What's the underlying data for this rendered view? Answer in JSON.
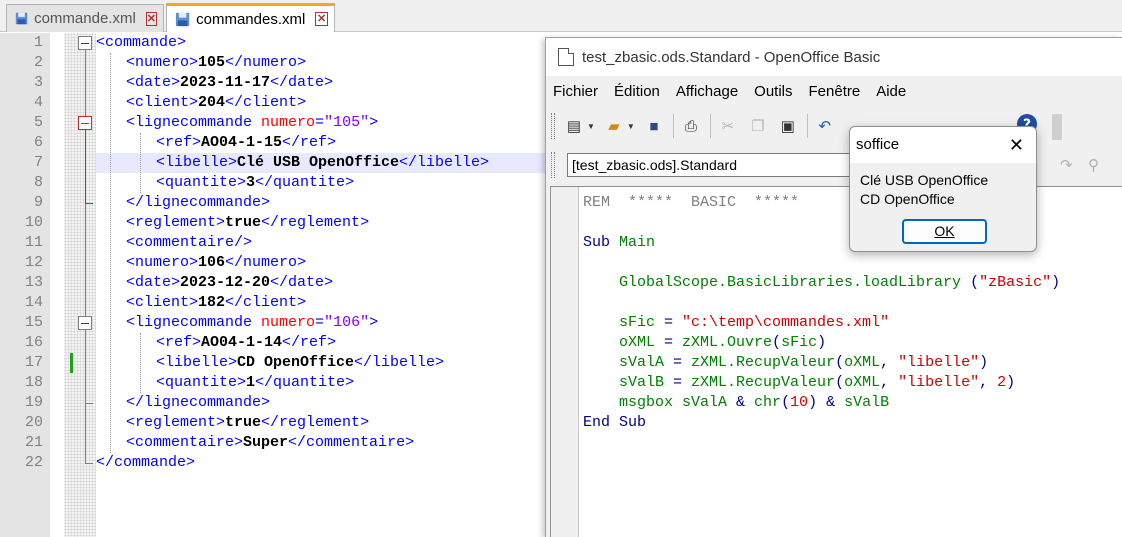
{
  "notepad": {
    "tabs": [
      {
        "label": "commande.xml"
      },
      {
        "label": "commandes.xml"
      }
    ]
  },
  "editor": {
    "lines": [
      {
        "n": "1",
        "seg": [
          [
            "t",
            "<commande>"
          ]
        ]
      },
      {
        "n": "2",
        "seg": [
          [
            "t",
            "<numero>"
          ],
          [
            "c",
            "105"
          ],
          [
            "t",
            "</numero>"
          ]
        ]
      },
      {
        "n": "3",
        "seg": [
          [
            "t",
            "<date>"
          ],
          [
            "c",
            "2023-11-17"
          ],
          [
            "t",
            "</date>"
          ]
        ]
      },
      {
        "n": "4",
        "seg": [
          [
            "t",
            "<client>"
          ],
          [
            "c",
            "204"
          ],
          [
            "t",
            "</client>"
          ]
        ]
      },
      {
        "n": "5",
        "seg": [
          [
            "t",
            "<lignecommande "
          ],
          [
            "a",
            "numero"
          ],
          [
            "t",
            "="
          ],
          [
            "v",
            "\"105\""
          ],
          [
            "t",
            ">"
          ]
        ]
      },
      {
        "n": "6",
        "seg": [
          [
            "t",
            "<ref>"
          ],
          [
            "c",
            "AO04-1-15"
          ],
          [
            "t",
            "</ref>"
          ]
        ]
      },
      {
        "n": "7",
        "seg": [
          [
            "t",
            "<libelle>"
          ],
          [
            "c",
            "Clé USB OpenOffice"
          ],
          [
            "t",
            "</libelle>"
          ]
        ]
      },
      {
        "n": "8",
        "seg": [
          [
            "t",
            "<quantite>"
          ],
          [
            "c",
            "3"
          ],
          [
            "t",
            "</quantite>"
          ]
        ]
      },
      {
        "n": "9",
        "seg": [
          [
            "t",
            "</lignecommande>"
          ]
        ]
      },
      {
        "n": "10",
        "seg": [
          [
            "t",
            "<reglement>"
          ],
          [
            "c",
            "true"
          ],
          [
            "t",
            "</reglement>"
          ]
        ]
      },
      {
        "n": "11",
        "seg": [
          [
            "t",
            "<commentaire/>"
          ]
        ]
      },
      {
        "n": "12",
        "seg": [
          [
            "t",
            "<numero>"
          ],
          [
            "c",
            "106"
          ],
          [
            "t",
            "</numero>"
          ]
        ]
      },
      {
        "n": "13",
        "seg": [
          [
            "t",
            "<date>"
          ],
          [
            "c",
            "2023-12-20"
          ],
          [
            "t",
            "</date>"
          ]
        ]
      },
      {
        "n": "14",
        "seg": [
          [
            "t",
            "<client>"
          ],
          [
            "c",
            "182"
          ],
          [
            "t",
            "</client>"
          ]
        ]
      },
      {
        "n": "15",
        "seg": [
          [
            "t",
            "<lignecommande "
          ],
          [
            "a",
            "numero"
          ],
          [
            "t",
            "="
          ],
          [
            "v",
            "\"106\""
          ],
          [
            "t",
            ">"
          ]
        ]
      },
      {
        "n": "16",
        "seg": [
          [
            "t",
            "<ref>"
          ],
          [
            "c",
            "AO04-1-14"
          ],
          [
            "t",
            "</ref>"
          ]
        ]
      },
      {
        "n": "17",
        "seg": [
          [
            "t",
            "<libelle>"
          ],
          [
            "c",
            "CD OpenOffice"
          ],
          [
            "t",
            "</libelle>"
          ]
        ]
      },
      {
        "n": "18",
        "seg": [
          [
            "t",
            "<quantite>"
          ],
          [
            "c",
            "1"
          ],
          [
            "t",
            "</quantite>"
          ]
        ]
      },
      {
        "n": "19",
        "seg": [
          [
            "t",
            "</lignecommande>"
          ]
        ]
      },
      {
        "n": "20",
        "seg": [
          [
            "t",
            "<reglement>"
          ],
          [
            "c",
            "true"
          ],
          [
            "t",
            "</reglement>"
          ]
        ]
      },
      {
        "n": "21",
        "seg": [
          [
            "t",
            "<commentaire>"
          ],
          [
            "c",
            "Super"
          ],
          [
            "t",
            "</commentaire>"
          ]
        ]
      },
      {
        "n": "22",
        "seg": [
          [
            "t",
            "</commande>"
          ]
        ]
      }
    ]
  },
  "basic": {
    "title": "test_zbasic.ods.Standard - OpenOffice Basic",
    "menu": [
      "Fichier",
      "Édition",
      "Affichage",
      "Outils",
      "Fenêtre",
      "Aide"
    ],
    "library": "[test_zbasic.ods].Standard",
    "code": [
      [
        [
          "rem",
          "REM  *****  BASIC  *****"
        ]
      ],
      [],
      [
        [
          "kw",
          "Sub "
        ],
        [
          "id",
          "Main"
        ]
      ],
      [],
      [
        [
          "id",
          "    GlobalScope.BasicLibraries.loadLibrary "
        ],
        [
          "kw",
          "("
        ],
        [
          "str",
          "\"zBasic\""
        ],
        [
          "kw",
          ")"
        ]
      ],
      [],
      [
        [
          "id",
          "    sFic "
        ],
        [
          "kw",
          "= "
        ],
        [
          "str",
          "\"c:\\temp\\commandes.xml\""
        ]
      ],
      [
        [
          "id",
          "    oXML "
        ],
        [
          "kw",
          "= "
        ],
        [
          "id",
          "zXML.Ouvre"
        ],
        [
          "kw",
          "("
        ],
        [
          "id",
          "sFic"
        ],
        [
          "kw",
          ")"
        ]
      ],
      [
        [
          "id",
          "    sValA "
        ],
        [
          "kw",
          "= "
        ],
        [
          "id",
          "zXML.RecupValeur"
        ],
        [
          "kw",
          "("
        ],
        [
          "id",
          "oXML"
        ],
        [
          "kw",
          ", "
        ],
        [
          "str",
          "\"libelle\""
        ],
        [
          "kw",
          ")"
        ]
      ],
      [
        [
          "id",
          "    sValB "
        ],
        [
          "kw",
          "= "
        ],
        [
          "id",
          "zXML.RecupValeur"
        ],
        [
          "kw",
          "("
        ],
        [
          "id",
          "oXML"
        ],
        [
          "kw",
          ", "
        ],
        [
          "str",
          "\"libelle\""
        ],
        [
          "kw",
          ", "
        ],
        [
          "num",
          "2"
        ],
        [
          "kw",
          ")"
        ]
      ],
      [
        [
          "id",
          "    msgbox sValA "
        ],
        [
          "kw",
          "& "
        ],
        [
          "id",
          "chr"
        ],
        [
          "kw",
          "("
        ],
        [
          "num",
          "10"
        ],
        [
          "kw",
          ") & "
        ],
        [
          "id",
          "sValB"
        ]
      ],
      [
        [
          "kw",
          "End Sub"
        ]
      ]
    ]
  },
  "dialog": {
    "title": "soffice",
    "line1": "Clé USB OpenOffice",
    "line2": "CD OpenOffice",
    "ok": "OK"
  }
}
